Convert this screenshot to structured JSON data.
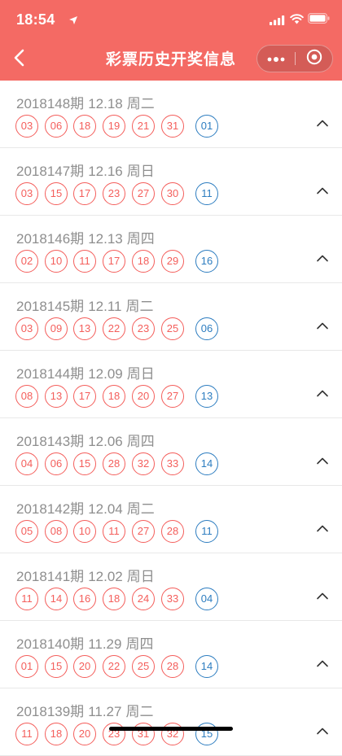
{
  "status_bar": {
    "time": "18:54"
  },
  "nav": {
    "title": "彩票历史开奖信息"
  },
  "colors": {
    "header": "#f46a64",
    "red_ball": "#f45e5b",
    "blue_ball": "#2d7dc0"
  },
  "draws": [
    {
      "issue": "2018148期",
      "date": "12.18",
      "weekday": "周二",
      "red": [
        "03",
        "06",
        "18",
        "19",
        "21",
        "31"
      ],
      "blue": "01"
    },
    {
      "issue": "2018147期",
      "date": "12.16",
      "weekday": "周日",
      "red": [
        "03",
        "15",
        "17",
        "23",
        "27",
        "30"
      ],
      "blue": "11"
    },
    {
      "issue": "2018146期",
      "date": "12.13",
      "weekday": "周四",
      "red": [
        "02",
        "10",
        "11",
        "17",
        "18",
        "29"
      ],
      "blue": "16"
    },
    {
      "issue": "2018145期",
      "date": "12.11",
      "weekday": "周二",
      "red": [
        "03",
        "09",
        "13",
        "22",
        "23",
        "25"
      ],
      "blue": "06"
    },
    {
      "issue": "2018144期",
      "date": "12.09",
      "weekday": "周日",
      "red": [
        "08",
        "13",
        "17",
        "18",
        "20",
        "27"
      ],
      "blue": "13"
    },
    {
      "issue": "2018143期",
      "date": "12.06",
      "weekday": "周四",
      "red": [
        "04",
        "06",
        "15",
        "28",
        "32",
        "33"
      ],
      "blue": "14"
    },
    {
      "issue": "2018142期",
      "date": "12.04",
      "weekday": "周二",
      "red": [
        "05",
        "08",
        "10",
        "11",
        "27",
        "28"
      ],
      "blue": "11"
    },
    {
      "issue": "2018141期",
      "date": "12.02",
      "weekday": "周日",
      "red": [
        "11",
        "14",
        "16",
        "18",
        "24",
        "33"
      ],
      "blue": "04"
    },
    {
      "issue": "2018140期",
      "date": "11.29",
      "weekday": "周四",
      "red": [
        "01",
        "15",
        "20",
        "22",
        "25",
        "28"
      ],
      "blue": "14"
    },
    {
      "issue": "2018139期",
      "date": "11.27",
      "weekday": "周二",
      "red": [
        "11",
        "18",
        "20",
        "23",
        "31",
        "32"
      ],
      "blue": "15"
    }
  ]
}
